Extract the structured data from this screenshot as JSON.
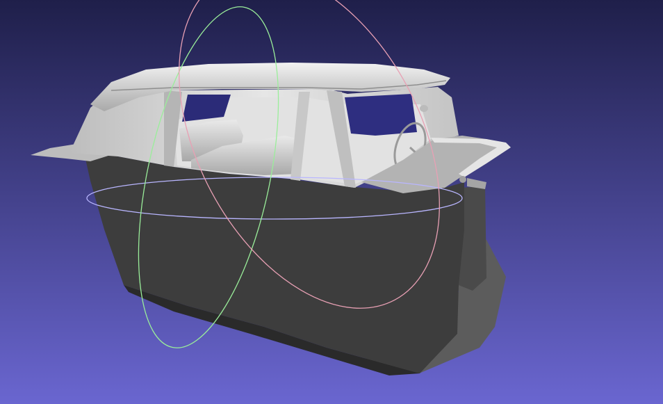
{
  "viewport": {
    "background_top": "#1f1f4a",
    "background_bottom": "#6a66d0"
  },
  "model": {
    "body_color": "#3d3d3d",
    "body_shadow_color": "#2a2a2a",
    "cabin_color": "#cfcfcf",
    "roof_color": "#dadada",
    "interior_color": "#e2e2e2",
    "under_color": "#5c5c5c"
  },
  "trackball": {
    "x_ring_color": "#e8a0b4",
    "y_ring_color": "#9aee9a",
    "z_ring_color": "#b9b6ff"
  }
}
